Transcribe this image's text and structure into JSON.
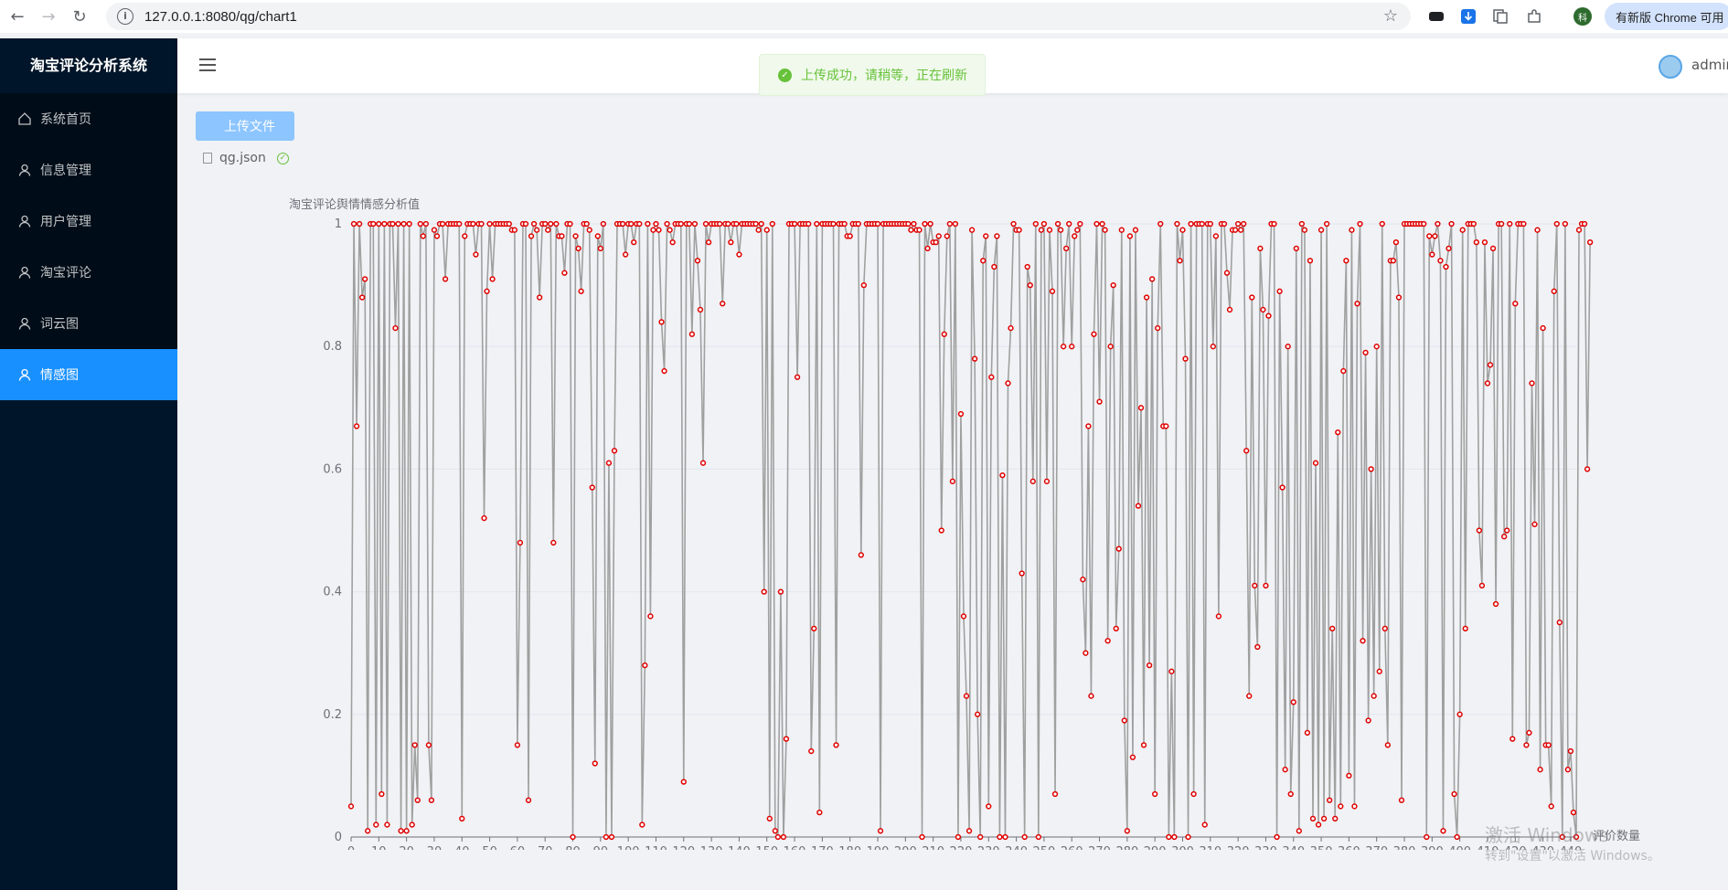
{
  "browser": {
    "url": "127.0.0.1:8080/qg/chart1",
    "update_label": "有新版 Chrome 可用",
    "profile_initial": "科"
  },
  "sidebar": {
    "title": "淘宝评论分析系统",
    "items": [
      {
        "label": "系统首页",
        "icon": "home-icon"
      },
      {
        "label": "信息管理",
        "icon": "user-icon"
      },
      {
        "label": "用户管理",
        "icon": "user-icon"
      },
      {
        "label": "淘宝评论",
        "icon": "user-icon"
      },
      {
        "label": "词云图",
        "icon": "user-icon"
      },
      {
        "label": "情感图",
        "icon": "user-icon",
        "active": true
      }
    ]
  },
  "header": {
    "user": "admin"
  },
  "toast": {
    "message": "上传成功，请稍等，正在刷新"
  },
  "upload": {
    "button_label": "上传文件",
    "file_name": "qg.json"
  },
  "watermark": {
    "line1": "激活 Windows",
    "line2": "转到\"设置\"以激活 Windows。"
  },
  "colors": {
    "sidebar_bg": "#001529",
    "active": "#1890ff",
    "line": "#a0a0a0",
    "point": "#e00000",
    "success": "#67c23a"
  },
  "chart_data": {
    "type": "line",
    "ylabel": "淘宝评论舆情情感分析值",
    "xlabel": "评价数量",
    "ylim": [
      0,
      1
    ],
    "xlim": [
      0,
      442
    ],
    "y_ticks": [
      0,
      0.2,
      0.4,
      0.6,
      0.8,
      1
    ],
    "x_ticks": [
      0,
      10,
      20,
      30,
      40,
      50,
      60,
      70,
      80,
      90,
      100,
      110,
      120,
      130,
      140,
      150,
      160,
      170,
      180,
      190,
      200,
      210,
      220,
      230,
      240,
      250,
      260,
      270,
      280,
      290,
      300,
      310,
      320,
      330,
      340,
      350,
      360,
      370,
      380,
      390,
      400,
      410,
      420,
      430,
      440
    ],
    "grid": true,
    "values": [
      0.05,
      1,
      0.67,
      1,
      0.88,
      0.91,
      0.01,
      1,
      1,
      0.02,
      1,
      0.07,
      1,
      0.02,
      1,
      1,
      0.83,
      1,
      0.01,
      1,
      0.01,
      1,
      0.02,
      0.15,
      0.06,
      1,
      0.98,
      1,
      0.15,
      0.06,
      0.99,
      0.98,
      1,
      1,
      0.91,
      1,
      1,
      1,
      1,
      1,
      0.03,
      0.98,
      1,
      1,
      1,
      0.95,
      1,
      1,
      0.52,
      0.89,
      1,
      0.91,
      1,
      1,
      1,
      1,
      1,
      1,
      0.99,
      0.99,
      0.15,
      0.48,
      1,
      1,
      0.06,
      0.98,
      1,
      0.99,
      0.88,
      1,
      1,
      0.99,
      1,
      0.48,
      1,
      0.98,
      0.98,
      0.92,
      1,
      1,
      0,
      0.98,
      0.96,
      0.89,
      1,
      1,
      0.99,
      0.57,
      0.12,
      0.98,
      0.96,
      1,
      0,
      0.61,
      0,
      0.63,
      1,
      1,
      1,
      0.95,
      1,
      1,
      0.97,
      1,
      1,
      0.02,
      0.28,
      1,
      0.36,
      0.99,
      1,
      0.99,
      0.84,
      0.76,
      1,
      0.99,
      0.97,
      1,
      1,
      1,
      0.09,
      1,
      1,
      0.82,
      1,
      0.94,
      0.86,
      0.61,
      1,
      0.97,
      1,
      1,
      1,
      1,
      0.87,
      1,
      1,
      0.97,
      1,
      1,
      0.95,
      1,
      1,
      1,
      1,
      1,
      1,
      0.99,
      1,
      0.4,
      0.99,
      0.03,
      1,
      0.01,
      0,
      0.4,
      0,
      0.16,
      1,
      1,
      1,
      0.75,
      1,
      1,
      1,
      1,
      0.14,
      0.34,
      1,
      0.04,
      1,
      1,
      1,
      1,
      1,
      0.15,
      1,
      1,
      1,
      0.98,
      0.98,
      1,
      1,
      1,
      0.46,
      0.9,
      1,
      1,
      1,
      1,
      1,
      0.01,
      1,
      1,
      1,
      1,
      1,
      1,
      1,
      1,
      1,
      1,
      0.99,
      1,
      0.99,
      0.99,
      0,
      1,
      0.96,
      1,
      0.97,
      0.97,
      0.98,
      0.5,
      0.82,
      0.98,
      1,
      0.58,
      1,
      0,
      0.69,
      0.36,
      0.23,
      0.01,
      0.99,
      0.78,
      0.2,
      0,
      0.94,
      0.98,
      0.05,
      0.75,
      0.93,
      0.98,
      0,
      0.59,
      0,
      0.74,
      0.83,
      1,
      0.99,
      0.99,
      0.43,
      0,
      0.93,
      0.9,
      0.58,
      1,
      0,
      0.99,
      1,
      0.58,
      0.99,
      0.89,
      0.07,
      1,
      0.99,
      0.8,
      0.96,
      1,
      0.8,
      0.98,
      0.99,
      1,
      0.42,
      0.3,
      0.67,
      0.23,
      0.82,
      1,
      0.71,
      1,
      0.99,
      0.32,
      0.8,
      0.9,
      0.34,
      0.47,
      0.99,
      0.19,
      0.01,
      0.98,
      0.13,
      0.99,
      0.54,
      0.7,
      0.15,
      0.88,
      0.28,
      0.91,
      0.07,
      0.83,
      1,
      0.67,
      0.67,
      0,
      0.27,
      0,
      1,
      0.94,
      0.99,
      0.78,
      0,
      1,
      0.07,
      1,
      1,
      1,
      0.02,
      1,
      1,
      0.8,
      0.98,
      0.36,
      1,
      1,
      0.92,
      0.86,
      0.99,
      0.99,
      1,
      0.99,
      1,
      0.63,
      0.23,
      0.88,
      0.41,
      0.31,
      0.96,
      0.86,
      0.41,
      0.85,
      1,
      1,
      0,
      0.89,
      0.57,
      0.11,
      0.8,
      0.07,
      0.22,
      0.96,
      0.01,
      1,
      0.99,
      0.17,
      0.94,
      0.03,
      0.61,
      0.02,
      0.99,
      0.03,
      1,
      0.06,
      0.34,
      0.03,
      0.66,
      0.05,
      0.76,
      0.94,
      0.1,
      0.99,
      0.05,
      0.87,
      1,
      0.32,
      0.79,
      0.19,
      0.6,
      0.23,
      0.8,
      0.27,
      1,
      0.34,
      0.15,
      0.94,
      0.94,
      0.97,
      0.88,
      0.06,
      1,
      1,
      1,
      1,
      1,
      1,
      1,
      1,
      0,
      0.98,
      0.95,
      0.98,
      1,
      0.94,
      0.01,
      0.93,
      0.96,
      1,
      0.07,
      0,
      0.2,
      0.99,
      0.34,
      1,
      1,
      1,
      0.97,
      0.5,
      0.41,
      0.97,
      0.74,
      0.77,
      0.96,
      0.38,
      1,
      1,
      0.49,
      0.5,
      1,
      0.16,
      0.87,
      1,
      1,
      1,
      0.15,
      0.17,
      0.74,
      0.51,
      0.99,
      0.11,
      0.83,
      0.15,
      0.15,
      0.05,
      0.89,
      1,
      0.35,
      0,
      1,
      0.11,
      0.14,
      0.04,
      0,
      0.99,
      1,
      1,
      0.6,
      0.97
    ]
  }
}
